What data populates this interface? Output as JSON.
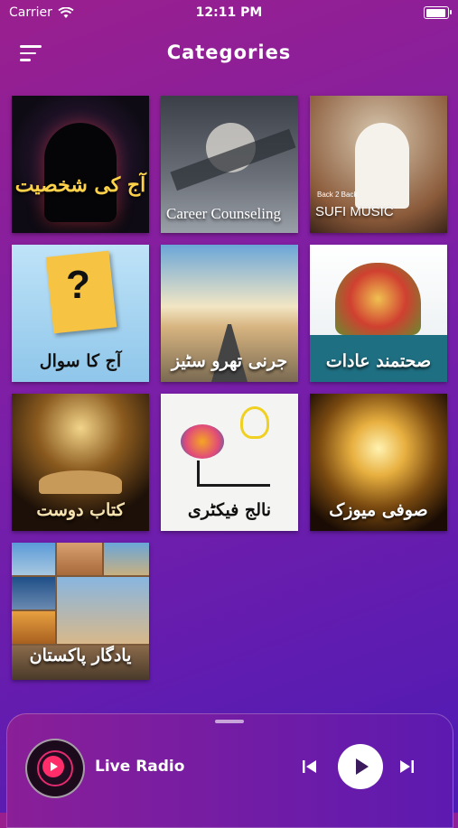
{
  "status_bar": {
    "carrier": "Carrier",
    "time": "12:11 PM"
  },
  "header": {
    "title": "Categories"
  },
  "categories": [
    {
      "caption": "آج کی شخصیت"
    },
    {
      "caption": "Career Counseling"
    },
    {
      "caption": "SUFI MUSIC",
      "subcaption": "Back 2 Back"
    },
    {
      "caption": "آج کا سوال"
    },
    {
      "caption": "جرنی تھرو سٹیز"
    },
    {
      "caption": "صحتمند عادات"
    },
    {
      "caption": "کتاب دوست"
    },
    {
      "caption": "نالج فیکٹری"
    },
    {
      "caption": "صوفی میوزک"
    },
    {
      "caption": "یادگار پاکستان"
    }
  ],
  "player": {
    "label": "Live Radio"
  },
  "colors": {
    "accent": "#ff2d6a",
    "bg_start": "#9a1f8e",
    "bg_end": "#4d1ab5"
  }
}
